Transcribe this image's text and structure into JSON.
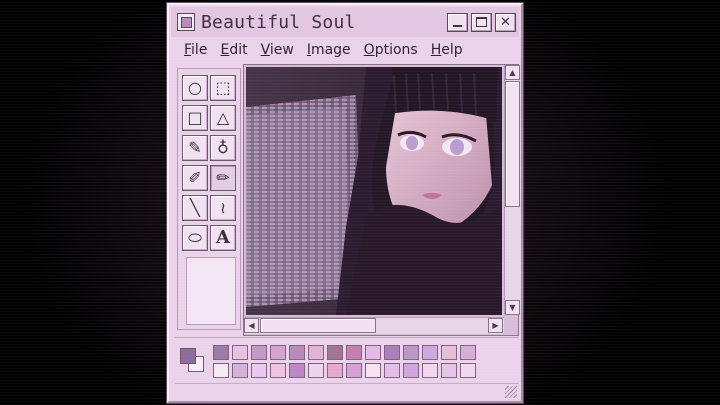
{
  "window": {
    "title": "Beautiful Soul",
    "icon": "paint-app-icon",
    "controls": {
      "minimize": "minimize-icon",
      "maximize": "maximize-icon",
      "close": "close-icon",
      "close_glyph": "✕"
    }
  },
  "menu": [
    "File",
    "Edit",
    "View",
    "Image",
    "Options",
    "Help"
  ],
  "tools": [
    {
      "name": "ellipse-select-tool",
      "glyph": "○"
    },
    {
      "name": "rect-select-tool",
      "glyph": "⬚"
    },
    {
      "name": "rectangle-tool",
      "glyph": "□"
    },
    {
      "name": "triangle-tool",
      "glyph": "△"
    },
    {
      "name": "color-picker-tool",
      "glyph": "✎"
    },
    {
      "name": "bottle-tool",
      "glyph": "♁"
    },
    {
      "name": "brush-tool",
      "glyph": "✐"
    },
    {
      "name": "pencil-tool",
      "glyph": "✏"
    },
    {
      "name": "line-tool",
      "glyph": "╲"
    },
    {
      "name": "curve-tool",
      "glyph": "≀"
    },
    {
      "name": "oval-tool",
      "glyph": "⬭"
    },
    {
      "name": "text-tool",
      "glyph": "A"
    }
  ],
  "palette": {
    "foreground": "#8c6a9a",
    "background": "#f7eef7",
    "row1": [
      "#9b7aa6",
      "#e7c2e0",
      "#c597c9",
      "#d3a2cf",
      "#b989b9",
      "#e3b1d8",
      "#a2738f",
      "#c47fae",
      "#e7b7e7",
      "#a97db5",
      "#b996c8",
      "#cba8df",
      "#e6bed6",
      "#d8acd9"
    ],
    "row2": [
      "#f4eaf4",
      "#d3b1d8",
      "#e9c7ef",
      "#f0c2e2",
      "#ba86c6",
      "#efd2ec",
      "#e7a8cf",
      "#d39fd5",
      "#f7e2f3",
      "#e1bde7",
      "#d1a4e0",
      "#f3d4ef",
      "#e5c5e8",
      "#f1d8ee"
    ]
  },
  "colors": {
    "window_face": "#ead3ea",
    "titlebar": "#e2c6e2",
    "text": "#3e2f3e"
  }
}
